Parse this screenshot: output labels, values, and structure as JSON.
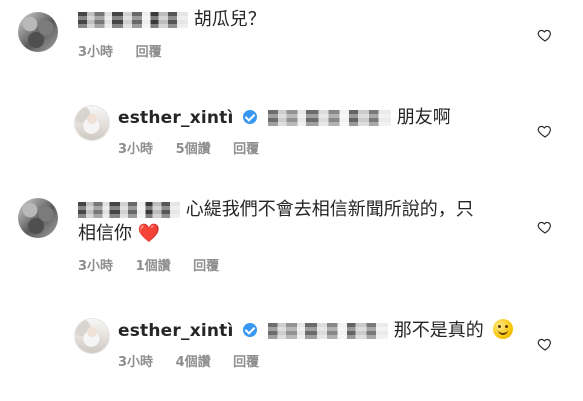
{
  "comments": [
    {
      "text": "胡瓜兒？",
      "time": "3小時",
      "reply": "回覆"
    },
    {
      "username": "esther_xintì",
      "text": "朋友啊",
      "time": "3小時",
      "likes": "5個讚",
      "reply": "回覆"
    },
    {
      "text_line1": "心緹我們不會去相信新聞所說的，只",
      "text_line2": "相信你",
      "emoji": "❤️",
      "time": "3小時",
      "likes": "1個讚",
      "reply": "回覆"
    },
    {
      "username": "esther_xintì",
      "text": "那不是真的",
      "emoji": "🙂",
      "time": "3小時",
      "likes": "4個讚",
      "reply": "回覆"
    }
  ],
  "icons": {
    "verified": "verified-badge-icon",
    "like": "heart-outline-icon"
  },
  "colors": {
    "text": "#262626",
    "meta": "#8e8e8e",
    "verified": "#3897f0",
    "heart_emoji": "#e0245e"
  }
}
